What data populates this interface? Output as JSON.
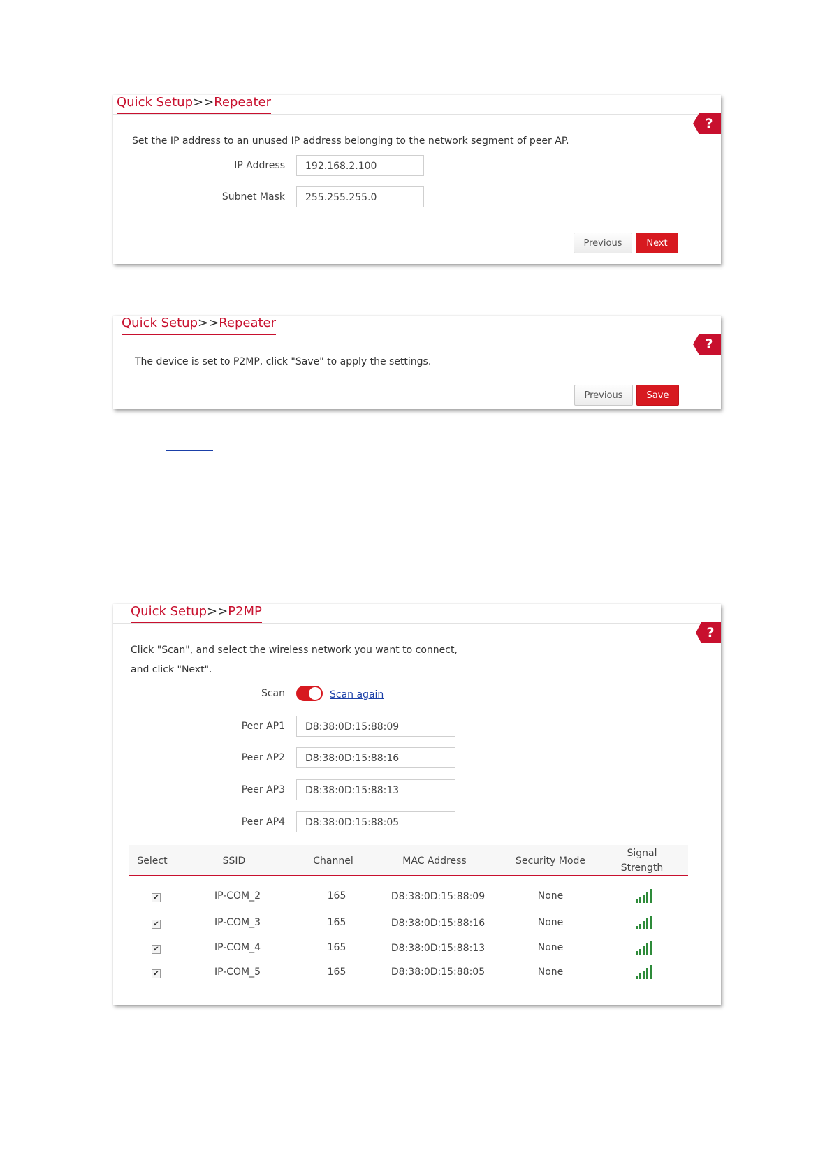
{
  "repeater_ip_panel": {
    "breadcrumb_a": "Quick Setup",
    "breadcrumb_sep": ">>",
    "breadcrumb_b": "Repeater",
    "help": "?",
    "description": "Set the IP address to an unused IP address belonging to the network segment of peer AP.",
    "ip_label": "IP Address",
    "ip_value": "192.168.2.100",
    "mask_label": "Subnet Mask",
    "mask_value": "255.255.255.0",
    "previous_label": "Previous",
    "next_label": "Next"
  },
  "repeater_save_panel": {
    "breadcrumb_a": "Quick Setup",
    "breadcrumb_sep": ">>",
    "breadcrumb_b": "Repeater",
    "help": "?",
    "description": "The device is set to P2MP, click \"Save\" to apply the settings.",
    "previous_label": "Previous",
    "save_label": "Save"
  },
  "p2mp_panel": {
    "breadcrumb_a": "Quick Setup",
    "breadcrumb_sep": ">>",
    "breadcrumb_b": "P2MP",
    "help": "?",
    "description_line1": "Click \"Scan\", and select the wireless network you want to connect,",
    "description_line2": "and click \"Next\".",
    "scan_label": "Scan",
    "scan_again": "Scan again",
    "peer_aps": [
      {
        "label": "Peer AP1",
        "value": "D8:38:0D:15:88:09"
      },
      {
        "label": "Peer AP2",
        "value": "D8:38:0D:15:88:16"
      },
      {
        "label": "Peer AP3",
        "value": "D8:38:0D:15:88:13"
      },
      {
        "label": "Peer AP4",
        "value": "D8:38:0D:15:88:05"
      }
    ],
    "table": {
      "headers": {
        "select": "Select",
        "ssid": "SSID",
        "channel": "Channel",
        "mac": "MAC Address",
        "security": "Security Mode",
        "signal_line1": "Signal",
        "signal_line2": "Strength"
      },
      "rows": [
        {
          "checked": "✔",
          "ssid": "IP-COM_2",
          "channel": "165",
          "mac": "D8:38:0D:15:88:09",
          "security": "None",
          "signal": "signal-strength-icon"
        },
        {
          "checked": "✔",
          "ssid": "IP-COM_3",
          "channel": "165",
          "mac": "D8:38:0D:15:88:16",
          "security": "None",
          "signal": "signal-strength-icon"
        },
        {
          "checked": "✔",
          "ssid": "IP-COM_4",
          "channel": "165",
          "mac": "D8:38:0D:15:88:13",
          "security": "None",
          "signal": "signal-strength-icon"
        },
        {
          "checked": "✔",
          "ssid": "IP-COM_5",
          "channel": "165",
          "mac": "D8:38:0D:15:88:05",
          "security": "None",
          "signal": "signal-strength-icon"
        }
      ]
    }
  },
  "colors": {
    "accent": "#c8102e",
    "button_red": "#d71920",
    "link_blue": "#1a3fa8",
    "signal_green": "#2e8b3a"
  }
}
